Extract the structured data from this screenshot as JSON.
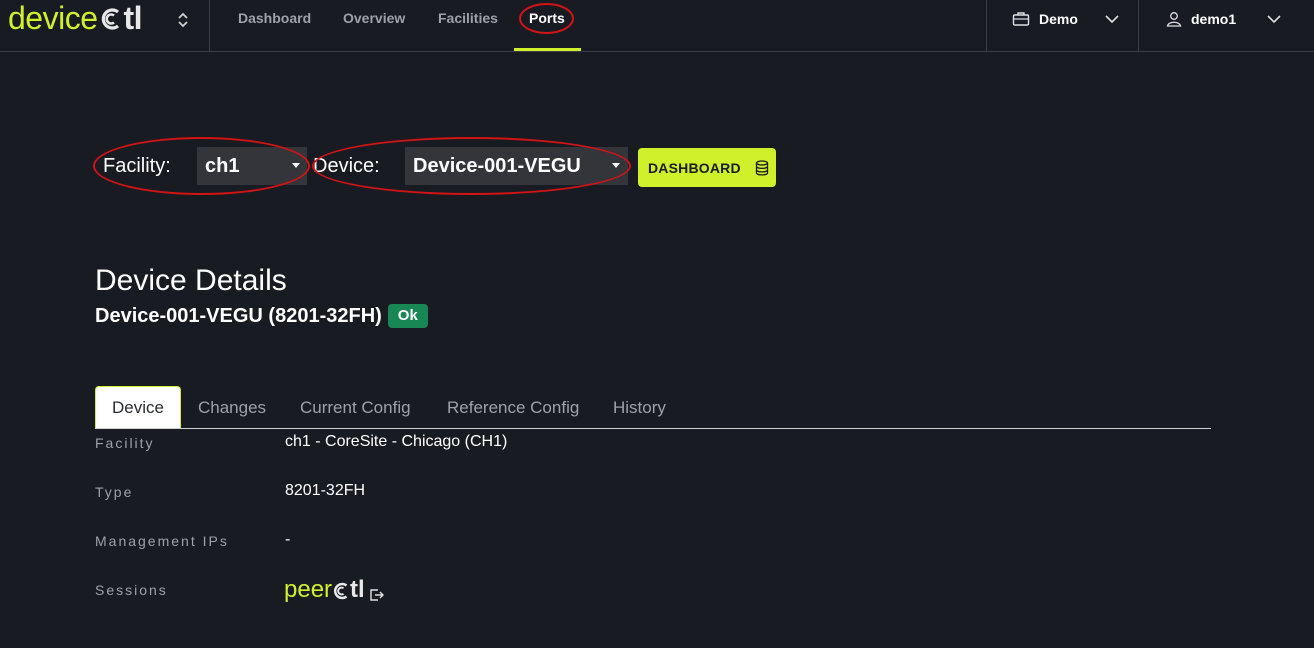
{
  "brand": {
    "logo_prefix": "device",
    "logo_suffix": "tl"
  },
  "nav": {
    "tabs": [
      {
        "label": "Dashboard"
      },
      {
        "label": "Overview"
      },
      {
        "label": "Facilities"
      },
      {
        "label": "Ports"
      }
    ],
    "active_tab": "Ports",
    "org_dropdown": "Demo",
    "user_dropdown": "demo1"
  },
  "filters": {
    "facility_label": "Facility:",
    "facility_value": "ch1",
    "device_label": "Device:",
    "device_value": "Device-001-VEGU",
    "dashboard_button": "DASHBOARD"
  },
  "details": {
    "title": "Device Details",
    "subtitle": "Device-001-VEGU (8201-32FH)",
    "status": "Ok",
    "status_color": "#198754",
    "tabs": [
      "Device",
      "Changes",
      "Current Config",
      "Reference Config",
      "History"
    ],
    "active_tab": "Device",
    "rows": [
      {
        "label": "Facility",
        "value": "ch1 - CoreSite - Chicago (CH1)"
      },
      {
        "label": "Type",
        "value": "8201-32FH"
      },
      {
        "label": "Management IPs",
        "value": "-"
      },
      {
        "label": "Sessions",
        "value": ""
      }
    ],
    "sessions_link": {
      "prefix": "peer",
      "suffix": "tl"
    }
  },
  "colors": {
    "accent": "#cff02a",
    "background": "#191b23",
    "annotation": "#d21414"
  }
}
